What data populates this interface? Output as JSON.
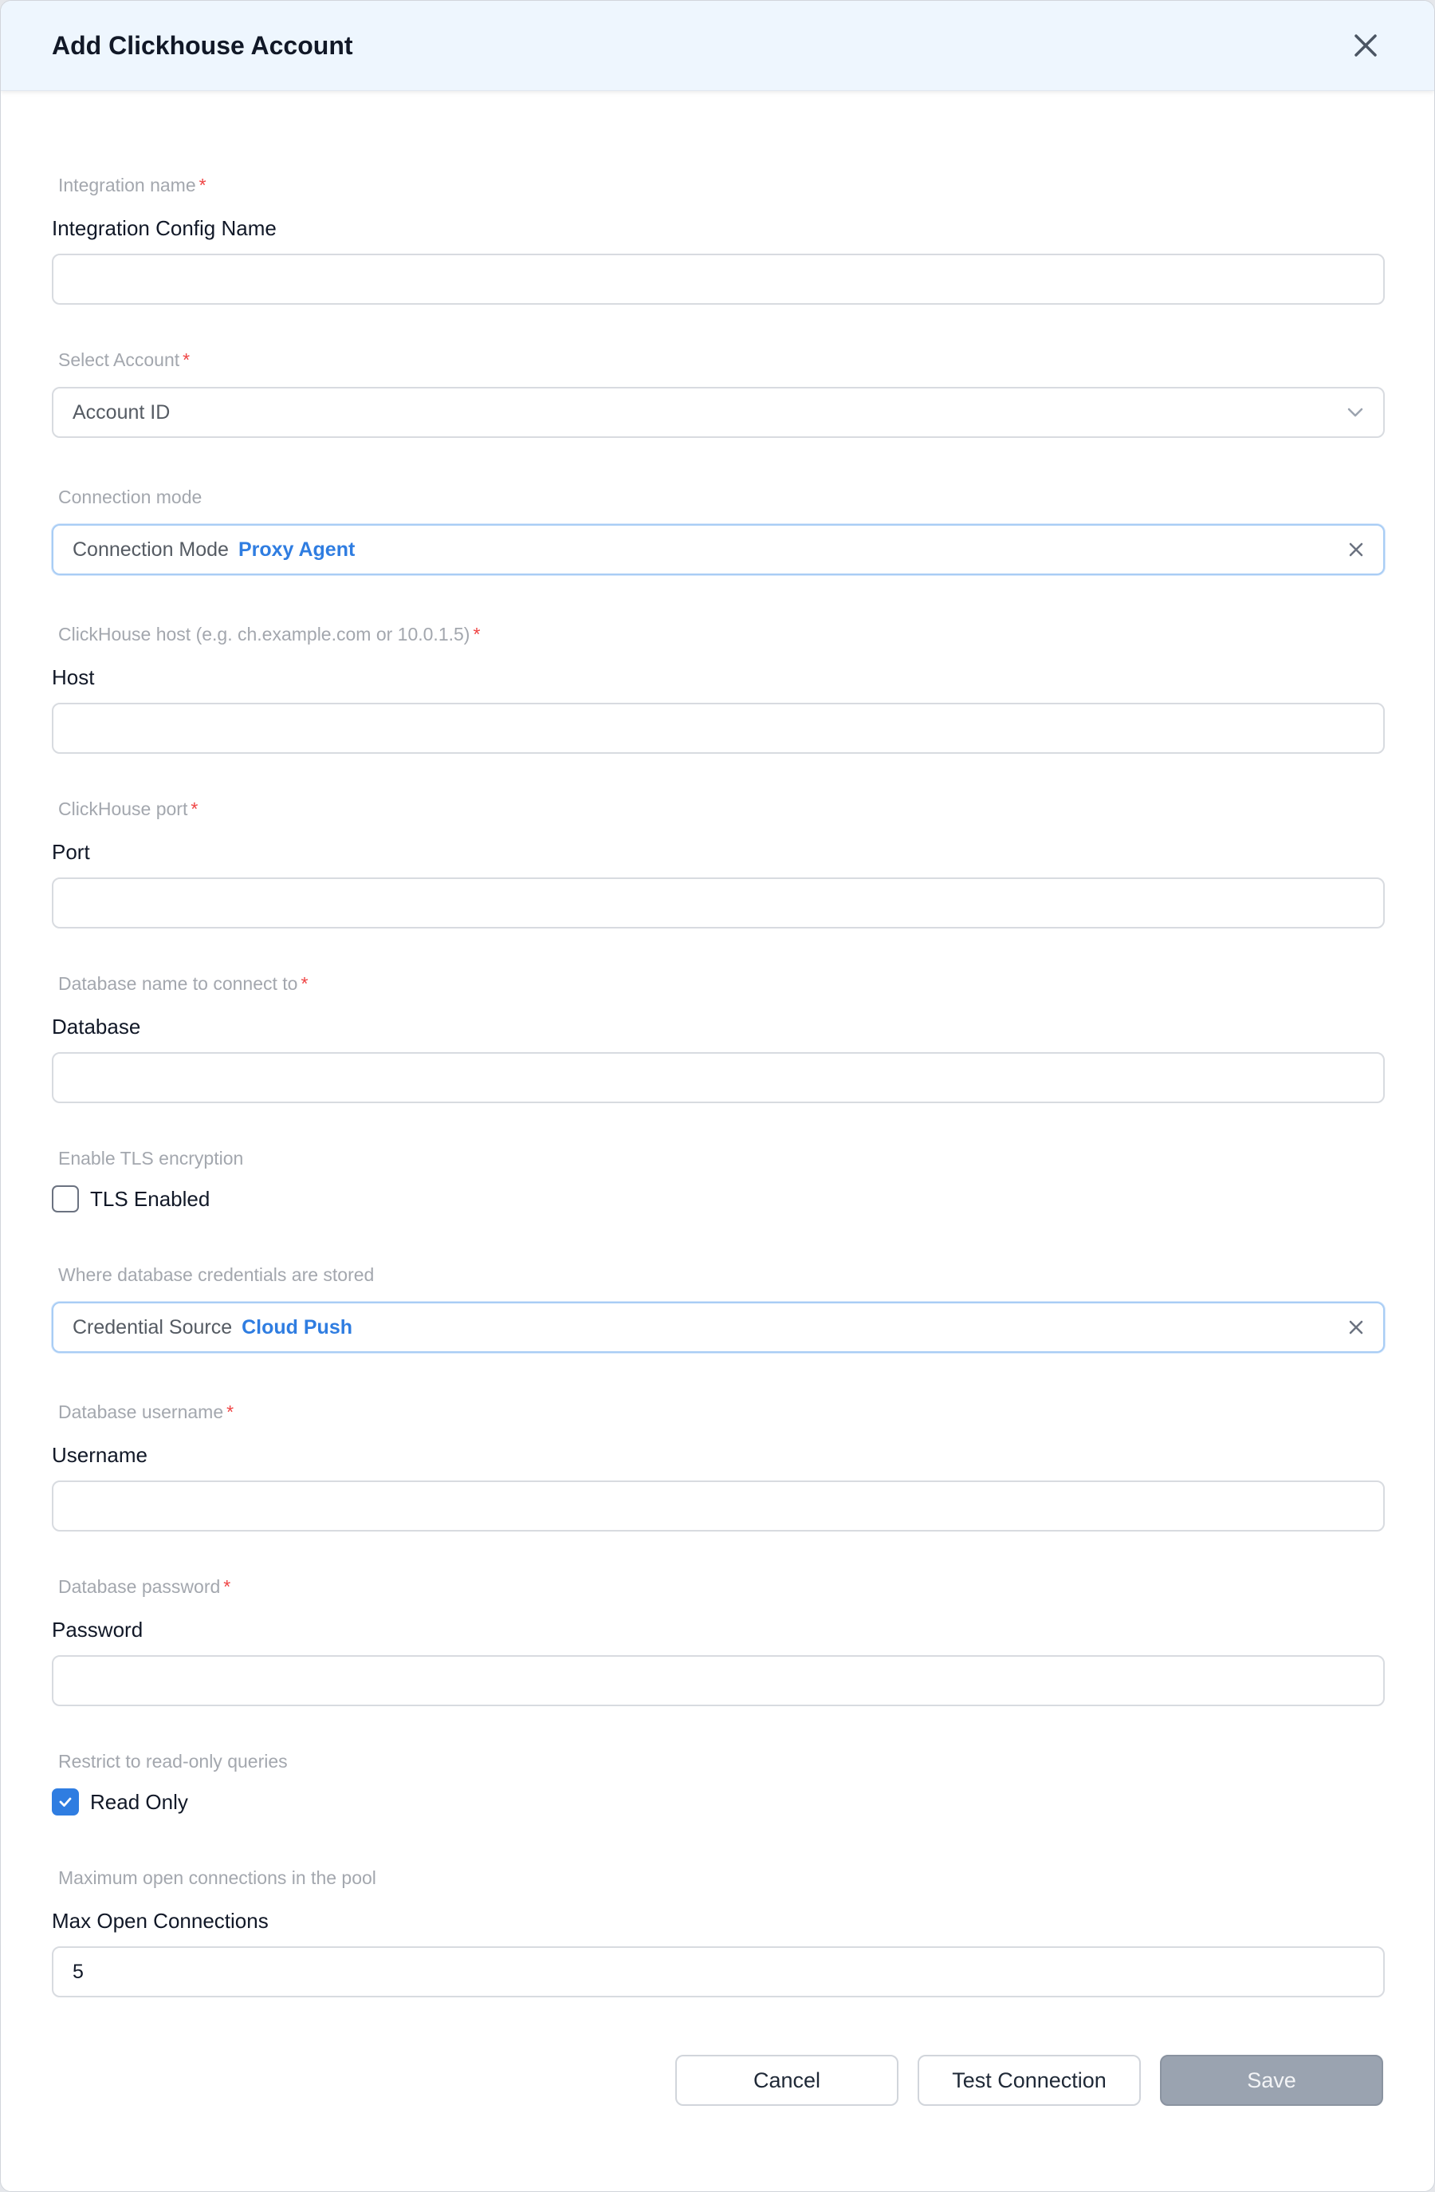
{
  "dialog": {
    "title": "Add Clickhouse Account"
  },
  "fields": {
    "integration_name": {
      "hint": "Integration name",
      "label": "Integration Config Name",
      "value": ""
    },
    "account": {
      "hint": "Select Account",
      "placeholder": "Account ID"
    },
    "connection_mode": {
      "hint": "Connection mode",
      "key": "Connection Mode",
      "value": "Proxy Agent"
    },
    "host": {
      "hint": "ClickHouse host (e.g. ch.example.com or 10.0.1.5)",
      "label": "Host",
      "value": ""
    },
    "port": {
      "hint": "ClickHouse port",
      "label": "Port",
      "value": ""
    },
    "database": {
      "hint": "Database name to connect to",
      "label": "Database",
      "value": ""
    },
    "tls": {
      "hint": "Enable TLS encryption",
      "label": "TLS Enabled",
      "checked": false
    },
    "credential_source": {
      "hint": "Where database credentials are stored",
      "key": "Credential Source",
      "value": "Cloud Push"
    },
    "username": {
      "hint": "Database username",
      "label": "Username",
      "value": ""
    },
    "password": {
      "hint": "Database password",
      "label": "Password",
      "value": ""
    },
    "read_only": {
      "hint": "Restrict to read-only queries",
      "label": "Read Only",
      "checked": true
    },
    "max_open_connections": {
      "hint": "Maximum open connections in the pool",
      "label": "Max Open Connections",
      "value": "5"
    }
  },
  "required_mark": "*",
  "buttons": {
    "cancel": "Cancel",
    "test": "Test Connection",
    "save": "Save"
  },
  "colors": {
    "accent": "#2f7de1",
    "required": "#ef4444",
    "save_disabled": "#9aa3b0"
  }
}
